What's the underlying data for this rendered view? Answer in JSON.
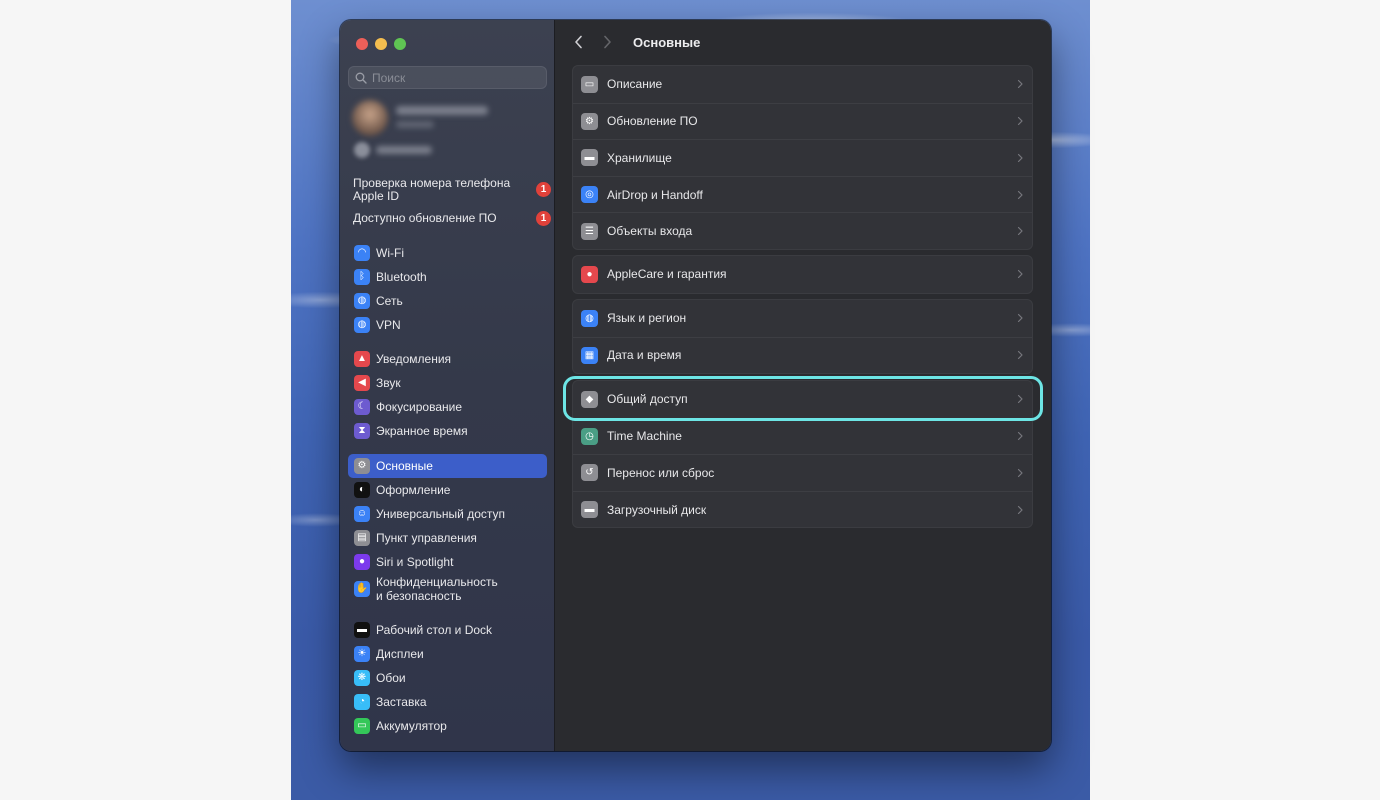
{
  "sidebar": {
    "search_placeholder": "Поиск",
    "notices": [
      {
        "label": "Проверка номера телефона Apple ID",
        "badge": "1"
      },
      {
        "label": "Доступно обновление ПО",
        "badge": "1"
      }
    ],
    "groups": [
      [
        {
          "label": "Wi-Fi",
          "icon": "wifi-icon",
          "color": "#3b82f6"
        },
        {
          "label": "Bluetooth",
          "icon": "bluetooth-icon",
          "color": "#3b82f6"
        },
        {
          "label": "Сеть",
          "icon": "globe-icon",
          "color": "#3b82f6"
        },
        {
          "label": "VPN",
          "icon": "vpn-globe-icon",
          "color": "#3b82f6"
        }
      ],
      [
        {
          "label": "Уведомления",
          "icon": "bell-icon",
          "color": "#e5484d"
        },
        {
          "label": "Звук",
          "icon": "speaker-icon",
          "color": "#e5484d"
        },
        {
          "label": "Фокусирование",
          "icon": "moon-icon",
          "color": "#6d5bd0"
        },
        {
          "label": "Экранное время",
          "icon": "hourglass-icon",
          "color": "#6d5bd0"
        }
      ],
      [
        {
          "label": "Основные",
          "icon": "gear-icon",
          "color": "#8e8e93",
          "selected": true
        },
        {
          "label": "Оформление",
          "icon": "appearance-icon",
          "color": "#111111"
        },
        {
          "label": "Универсальный доступ",
          "icon": "accessibility-icon",
          "color": "#3b82f6"
        },
        {
          "label": "Пункт управления",
          "icon": "control-center-icon",
          "color": "#8e8e93"
        },
        {
          "label": "Siri и Spotlight",
          "icon": "siri-icon",
          "color": "#7c3aed"
        },
        {
          "label": "Конфиденциальность\nи безопасность",
          "icon": "hand-icon",
          "color": "#3b82f6",
          "tall": true
        }
      ],
      [
        {
          "label": "Рабочий стол и Dock",
          "icon": "dock-icon",
          "color": "#111111"
        },
        {
          "label": "Дисплеи",
          "icon": "sun-icon",
          "color": "#3b82f6"
        },
        {
          "label": "Обои",
          "icon": "flower-icon",
          "color": "#38bdf8"
        },
        {
          "label": "Заставка",
          "icon": "screensaver-icon",
          "color": "#38bdf8"
        },
        {
          "label": "Аккумулятор",
          "icon": "battery-icon",
          "color": "#34c759"
        }
      ]
    ]
  },
  "main": {
    "title": "Основные",
    "cards": [
      [
        {
          "label": "Описание",
          "icon": "laptop-icon",
          "color": "#8e8e93"
        },
        {
          "label": "Обновление ПО",
          "icon": "software-update-icon",
          "color": "#8e8e93"
        },
        {
          "label": "Хранилище",
          "icon": "storage-icon",
          "color": "#8e8e93"
        },
        {
          "label": "AirDrop и Handoff",
          "icon": "airdrop-icon",
          "color": "#3b82f6"
        },
        {
          "label": "Объекты входа",
          "icon": "list-icon",
          "color": "#8e8e93"
        }
      ],
      [
        {
          "label": "AppleCare и гарантия",
          "icon": "apple-icon",
          "color": "#e5484d"
        }
      ],
      [
        {
          "label": "Язык и регион",
          "icon": "globe-icon",
          "color": "#3b82f6"
        },
        {
          "label": "Дата и время",
          "icon": "calendar-icon",
          "color": "#3b82f6"
        }
      ],
      [
        {
          "label": "Общий доступ",
          "icon": "sharing-icon",
          "color": "#8e8e93",
          "highlighted": true
        },
        {
          "label": "Time Machine",
          "icon": "time-machine-icon",
          "color": "#4a9e85"
        },
        {
          "label": "Перенос или сброс",
          "icon": "reset-icon",
          "color": "#8e8e93"
        },
        {
          "label": "Загрузочный диск",
          "icon": "disk-icon",
          "color": "#8e8e93"
        }
      ]
    ]
  }
}
